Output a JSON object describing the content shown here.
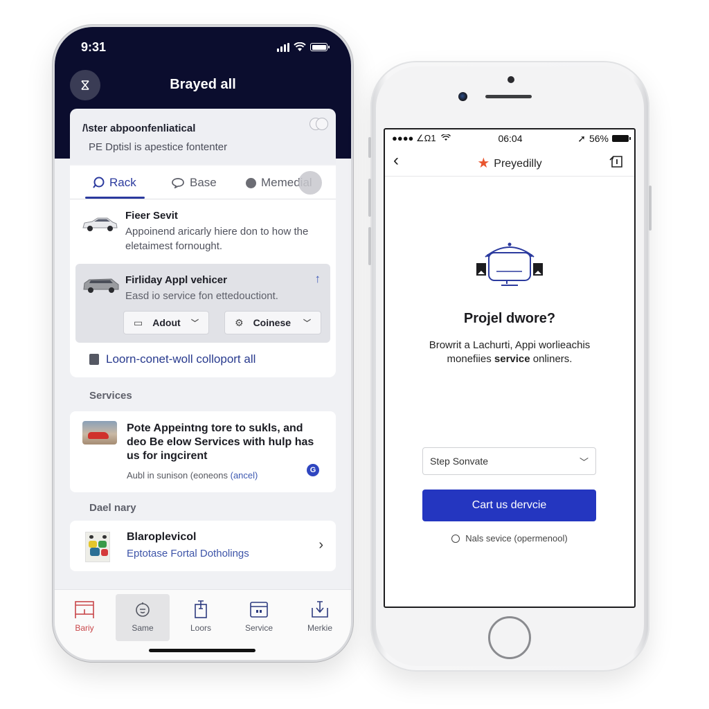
{
  "left_phone": {
    "status": {
      "time": "9:31"
    },
    "header": {
      "title": "Brayed all",
      "close_icon": "close-icon"
    },
    "notice": {
      "title": "/\\ster abpoonfenliatical",
      "subtitle": "PE Dptisl is apestice fontenter"
    },
    "tabs": [
      {
        "label": "Rack",
        "icon": "chat-icon",
        "active": true
      },
      {
        "label": "Base",
        "icon": "speech-bubble-icon",
        "active": false
      },
      {
        "label": "Memedial",
        "icon": "circle-icon",
        "active": false
      }
    ],
    "items": [
      {
        "title": "Fieer Sevit",
        "text": "Appoinend aricarly hiere don to how the eletaimest fornought."
      },
      {
        "title": "Firliday Appl vehicer",
        "text": "Easd io service fon ettedouctiont.",
        "selects": [
          "Adout",
          "Coinese"
        ]
      }
    ],
    "link": "Loorn-conet-woll colloport all",
    "services": {
      "section_label": "Services",
      "title": "Pote Appeintng tore to sukls, and deo Be elow Services with hulp has us for ingcirent",
      "sub_prefix": "Aubl in sunison (eoneons ",
      "sub_link": "(ancel)"
    },
    "daily": {
      "section_label": "Dael nary",
      "title": "Blaroplevicol",
      "subtitle": "Eptotase Fortal Dotholings"
    },
    "tabbar": [
      {
        "label": "Bariy",
        "icon": "home-icon",
        "active": true
      },
      {
        "label": "Same",
        "icon": "face-icon",
        "highlighted": true
      },
      {
        "label": "Loors",
        "icon": "clipboard-icon"
      },
      {
        "label": "Service",
        "icon": "calendar-icon"
      },
      {
        "label": "Merkie",
        "icon": "download-icon"
      }
    ],
    "colors": {
      "header_bg": "#0b0d2e",
      "accent": "#2b3a9e",
      "active_tab": "#c9474a"
    }
  },
  "right_phone": {
    "status": {
      "carrier": "●●●● ∠Ω1",
      "time": "06:04",
      "battery": "56%"
    },
    "nav": {
      "title": "Preyedilly"
    },
    "heading": "Projel dwore?",
    "body_line1": "Browrit a Lachurti, Appi worlieachis",
    "body_line2_pre": "monefiies ",
    "body_line2_bold": "service",
    "body_line2_post": " onliners.",
    "select": {
      "value": "Step Sonvate"
    },
    "cta": "Cart us dervcie",
    "radio_label": "Nals sevice (opermenool)",
    "colors": {
      "cta": "#2436c0",
      "star": "#e8552f"
    }
  }
}
